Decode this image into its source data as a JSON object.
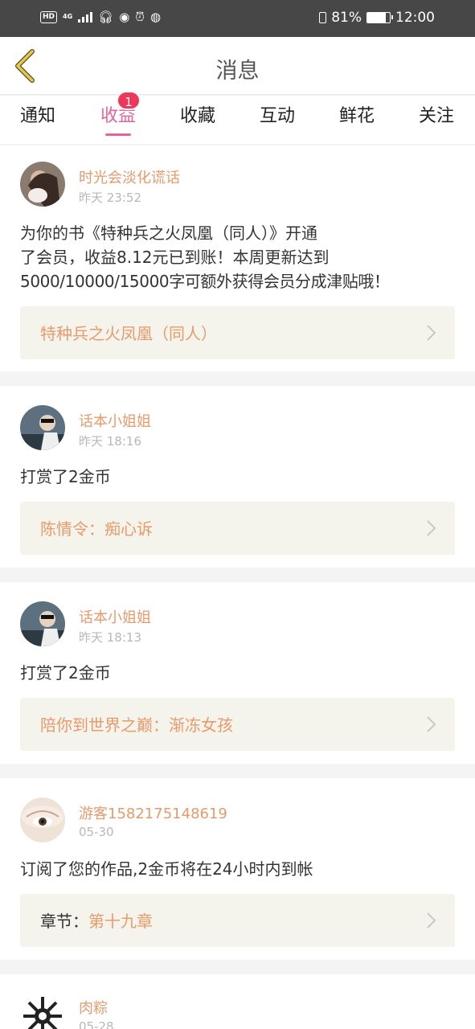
{
  "status_bar": {
    "hd": "HD",
    "network": "4G",
    "battery": "81%",
    "battery_level": 0.81,
    "time": "12:00"
  },
  "header": {
    "title": "消息",
    "back_icon": "chevron-left-icon"
  },
  "tabs": [
    {
      "label": "通知",
      "active": false
    },
    {
      "label": "收益",
      "active": true,
      "badge": "1"
    },
    {
      "label": "收藏",
      "active": false
    },
    {
      "label": "互动",
      "active": false
    },
    {
      "label": "鲜花",
      "active": false
    },
    {
      "label": "关注",
      "active": false
    }
  ],
  "messages": [
    {
      "name": "时光会淡化谎话",
      "time": "昨天 23:52",
      "text_lines": [
        "为你的书《特种兵之火凤凰（同人）》开通",
        "了会员，收益8.12元已到账！本周更新达到",
        "5000/10000/15000字可额外获得会员分成津贴哦！"
      ],
      "link": "特种兵之火凤凰（同人）"
    },
    {
      "name": "话本小姐姐",
      "time": "昨天 18:16",
      "text_lines": [
        "打赏了2金币"
      ],
      "link": "陈情令：痴心诉"
    },
    {
      "name": "话本小姐姐",
      "time": "昨天 18:13",
      "text_lines": [
        "打赏了2金币"
      ],
      "link": "陪你到世界之巅：渐冻女孩"
    },
    {
      "name": "游客1582175148619",
      "time": "05-30",
      "text_lines": [
        "订阅了您的作品,2金币将在24小时内到帐"
      ],
      "link_prefix": "章节：",
      "link": "第十九章"
    },
    {
      "name": "肉粽",
      "time": "05-28"
    }
  ],
  "colors": {
    "accent_pink": "#e8639a",
    "name_orange": "#e79a6b",
    "badge_red": "#f0365a",
    "link_bg": "#f5f4ec",
    "back_arrow": "#e6c84a"
  }
}
